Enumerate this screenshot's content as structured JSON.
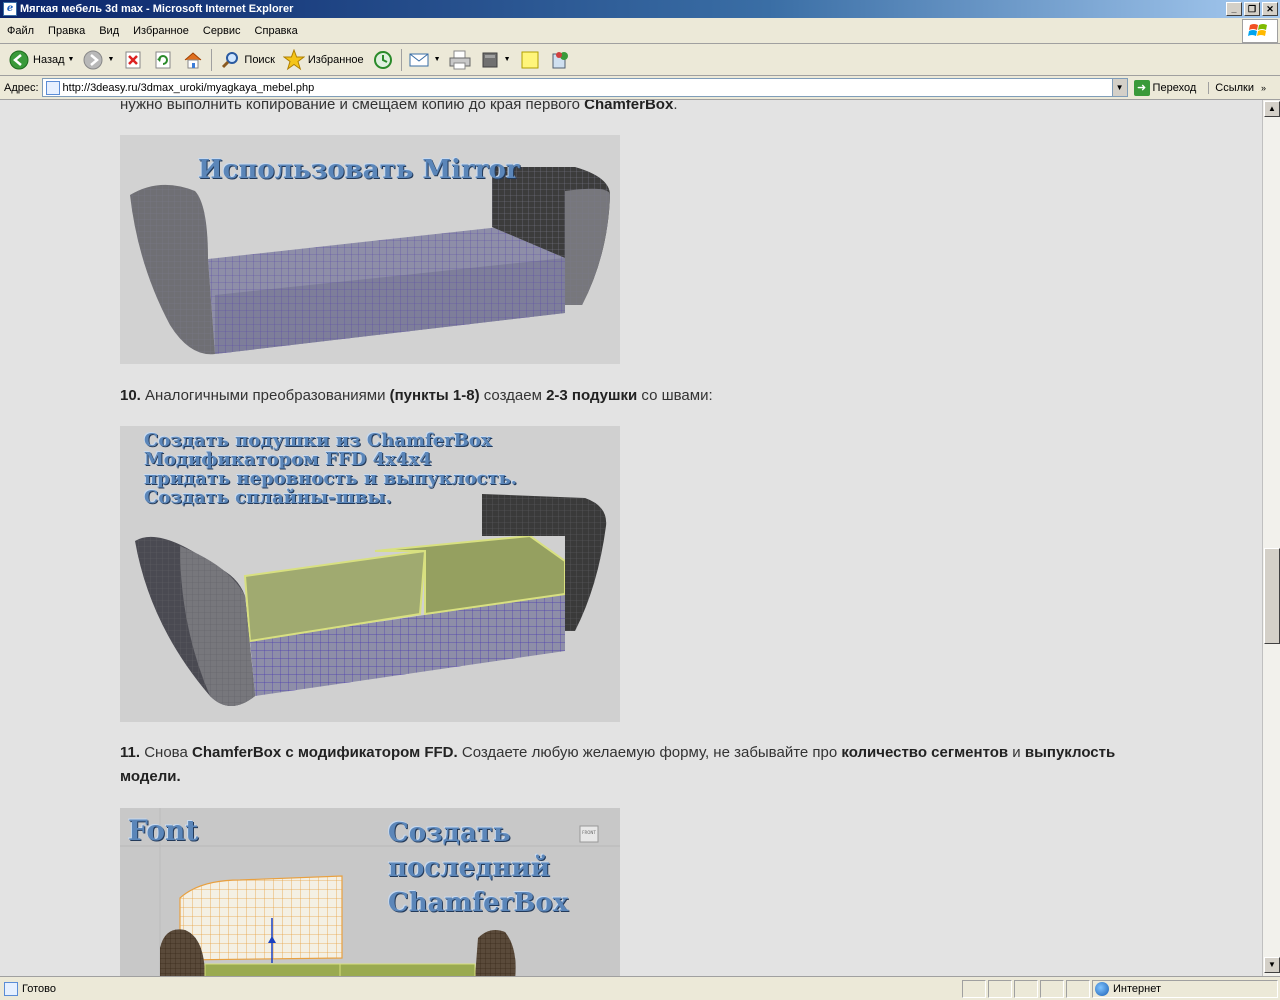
{
  "window": {
    "title": "Мягкая мебель 3d max - Microsoft Internet Explorer",
    "btn_min": "_",
    "btn_max": "❐",
    "btn_close": "✕"
  },
  "menubar": {
    "items": [
      "Файл",
      "Правка",
      "Вид",
      "Избранное",
      "Сервис",
      "Справка"
    ]
  },
  "toolbar": {
    "back": "Назад",
    "search": "Поиск",
    "favorites": "Избранное"
  },
  "address": {
    "label": "Адрес:",
    "url": "http://3deasy.ru/3dmax_uroki/myagkaya_mebel.php",
    "go": "Переход",
    "links": "Ссылки"
  },
  "article": {
    "top_line_plain": "нужно выполнить копирование и смещаем копию до края первого",
    "top_line_bold": "ChamferBox",
    "top_line_end": ".",
    "image1_caption": "Использовать Mirror",
    "step10_num": "10.",
    "step10_a": "Аналогичными преобразованиями",
    "step10_b": "(пункты 1-8)",
    "step10_c": "создаем",
    "step10_d": "2-3 подушки",
    "step10_e": "со швами:",
    "image2_caption_lines": [
      "Создать подушки из ChamferBox",
      "Модификатором FFD 4x4x4",
      "придать неровность и выпуклость.",
      "Создать сплайны-швы."
    ],
    "step11_num": "11.",
    "step11_a": "Снова",
    "step11_b": "ChamferBox с модификатором FFD.",
    "step11_c": "Создаете любую желаемую форму, не забывайте про",
    "step11_d": "количество сегментов",
    "step11_e": "и",
    "step11_f": "выпуклость модели.",
    "image3_caption_left": "Font",
    "image3_caption_right_lines": [
      "Создать",
      "последний",
      "ChamferBox"
    ],
    "image3_viewport_label": "FRONT"
  },
  "status": {
    "text": "Готово",
    "zone": "Интернет"
  }
}
